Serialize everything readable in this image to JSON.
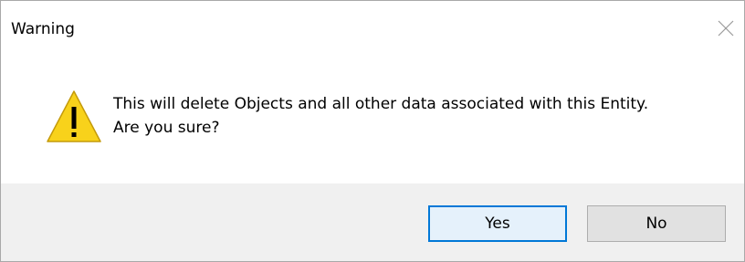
{
  "dialog": {
    "title": "Warning",
    "close_icon": "close-icon",
    "message_lines": [
      "This will delete Objects and all other data associated with this Entity.",
      "Are you sure?"
    ],
    "icon": "warning-icon",
    "buttons": {
      "yes_label": "Yes",
      "no_label": "No"
    },
    "colors": {
      "footer_bg": "#f0f0f0",
      "default_button_border": "#0078d7",
      "warning_yellow": "#f8d21b"
    }
  }
}
